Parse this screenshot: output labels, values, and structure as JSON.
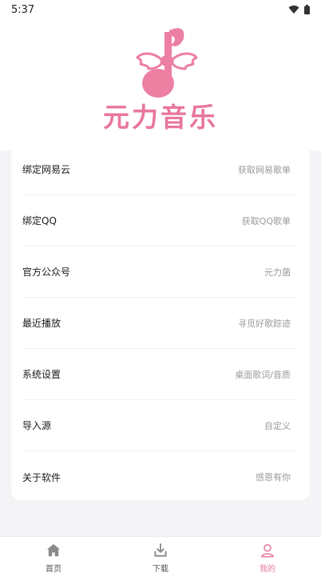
{
  "status_bar": {
    "time": "5:37",
    "icons": [
      "wifi-icon",
      "battery-icon"
    ]
  },
  "brand": {
    "name": "元力音乐",
    "logo_icon": "music-note-with-wings-icon",
    "color": "#e8779b"
  },
  "menu": {
    "items": [
      {
        "label": "绑定网易云",
        "hint": "获取网易歌单"
      },
      {
        "label": "绑定QQ",
        "hint": "获取QQ歌单"
      },
      {
        "label": "官方公众号",
        "hint": "元力菌"
      },
      {
        "label": "最近播放",
        "hint": "寻觅好歌踪迹"
      },
      {
        "label": "系统设置",
        "hint": "桌面歌词/音质"
      },
      {
        "label": "导入源",
        "hint": "自定义"
      },
      {
        "label": "关于软件",
        "hint": "感恩有你"
      }
    ]
  },
  "bottom_nav": {
    "items": [
      {
        "label": "首页",
        "icon": "home-icon",
        "active": false
      },
      {
        "label": "下载",
        "icon": "download-icon",
        "active": false
      },
      {
        "label": "我的",
        "icon": "user-icon",
        "active": true
      }
    ],
    "active_color": "#e8779b"
  }
}
